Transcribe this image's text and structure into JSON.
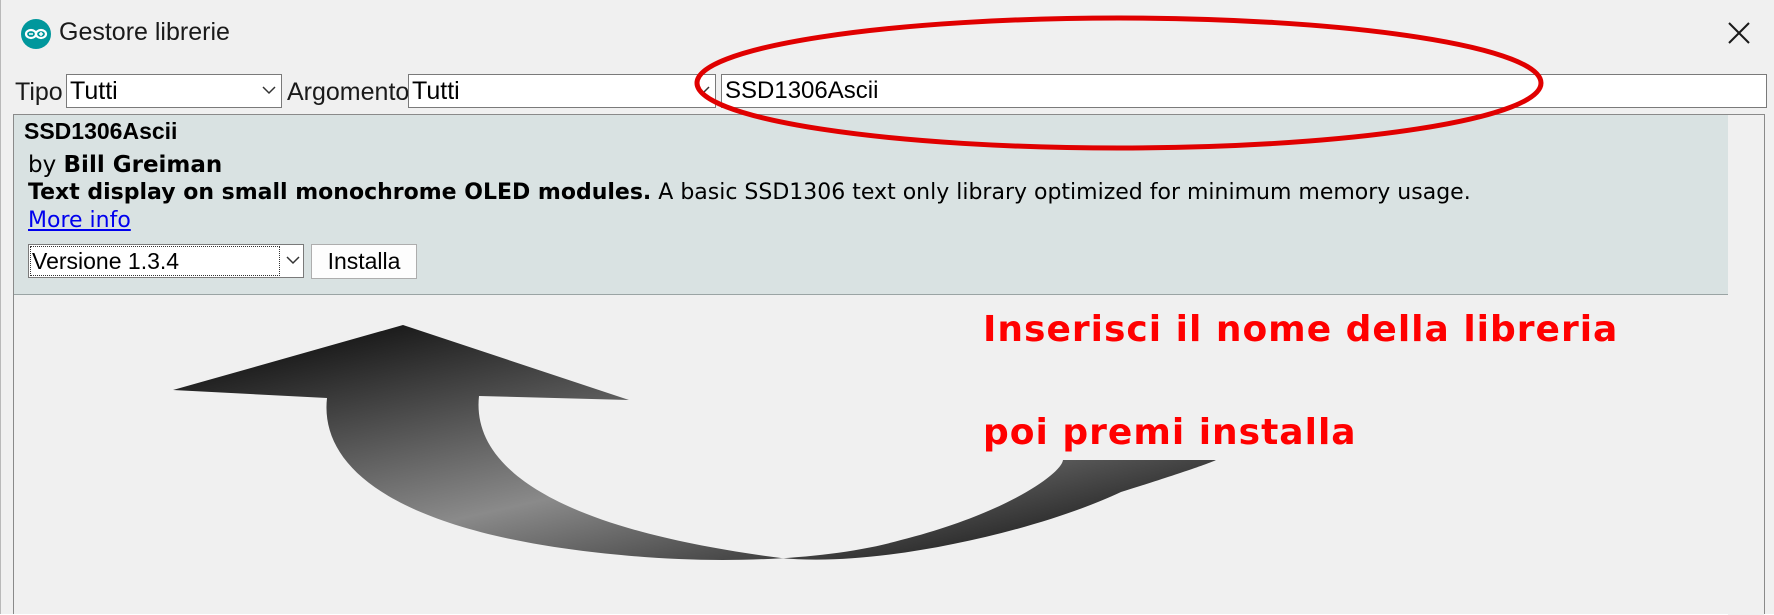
{
  "window": {
    "title": "Gestore librerie"
  },
  "toolbar": {
    "tipo_label": "Tipo",
    "tipo_value": "Tutti",
    "argomento_label": "Argomento",
    "argomento_value": "Tutti",
    "search_value": "SSD1306Ascii"
  },
  "library": {
    "name": "SSD1306Ascii",
    "by_prefix": "by",
    "author": "Bill Greiman",
    "summary": "Text display on small monochrome OLED modules.",
    "description": "A basic SSD1306 text only library optimized for minimum memory usage.",
    "more_info": "More info",
    "version": "Versione 1.3.4",
    "install_label": "Installa"
  },
  "annotation": {
    "line1": "Inserisci il nome della libreria",
    "line2": "poi premi installa",
    "color": "#ff0000"
  },
  "colors": {
    "accent": "#00979c",
    "item_bg": "#d9e2e2",
    "window_bg": "#f0f0f0"
  }
}
